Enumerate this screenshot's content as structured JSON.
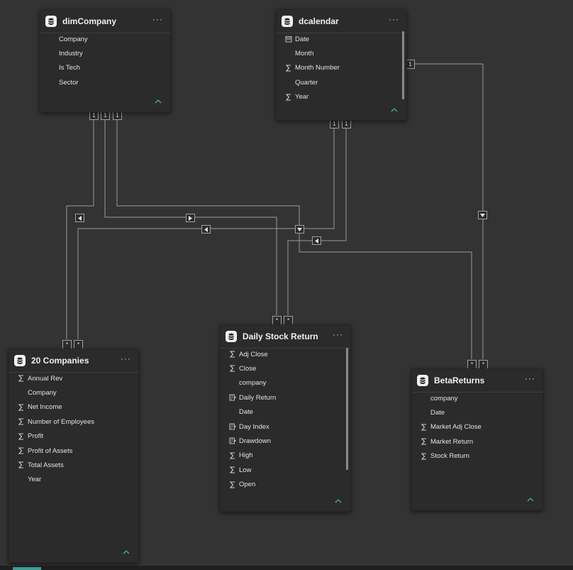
{
  "tables": {
    "dimCompany": {
      "title": "dimCompany",
      "fields": [
        {
          "label": "Company",
          "icon": ""
        },
        {
          "label": "Industry",
          "icon": ""
        },
        {
          "label": "Is Tech",
          "icon": ""
        },
        {
          "label": "Sector",
          "icon": ""
        }
      ]
    },
    "dcalendar": {
      "title": "dcalendar",
      "fields": [
        {
          "label": "Date",
          "icon": "calendar-icon"
        },
        {
          "label": "Month",
          "icon": ""
        },
        {
          "label": "Month Number",
          "icon": "sigma-icon"
        },
        {
          "label": "Quarter",
          "icon": ""
        },
        {
          "label": "Year",
          "icon": "sigma-icon"
        }
      ]
    },
    "companies20": {
      "title": "20 Companies",
      "fields": [
        {
          "label": "Annual Rev",
          "icon": "sigma-icon"
        },
        {
          "label": "Company",
          "icon": ""
        },
        {
          "label": "Net Income",
          "icon": "sigma-icon"
        },
        {
          "label": "Number of Employees",
          "icon": "sigma-icon"
        },
        {
          "label": "Profit",
          "icon": "sigma-icon"
        },
        {
          "label": "Profit of Assets",
          "icon": "sigma-icon"
        },
        {
          "label": "Total Assets",
          "icon": "sigma-icon"
        },
        {
          "label": "Year",
          "icon": ""
        }
      ]
    },
    "dailyStockReturn": {
      "title": "Daily Stock Return",
      "fields": [
        {
          "label": "Adj Close",
          "icon": "sigma-icon"
        },
        {
          "label": "Close",
          "icon": "sigma-icon"
        },
        {
          "label": "company",
          "icon": ""
        },
        {
          "label": "Daily Return",
          "icon": "calculator-icon"
        },
        {
          "label": "Date",
          "icon": ""
        },
        {
          "label": "Day Index",
          "icon": "calculator-icon"
        },
        {
          "label": "Drawdown",
          "icon": "calculator-icon"
        },
        {
          "label": "High",
          "icon": "sigma-icon"
        },
        {
          "label": "Low",
          "icon": "sigma-icon"
        },
        {
          "label": "Open",
          "icon": "sigma-icon"
        }
      ]
    },
    "betaReturns": {
      "title": "BetaReturns",
      "fields": [
        {
          "label": "company",
          "icon": ""
        },
        {
          "label": "Date",
          "icon": ""
        },
        {
          "label": "Market Adj Close",
          "icon": "sigma-icon"
        },
        {
          "label": "Market Return",
          "icon": "sigma-icon"
        },
        {
          "label": "Stock Return",
          "icon": "sigma-icon"
        }
      ]
    }
  },
  "menu_label": "···",
  "cardinality": {
    "one": "1",
    "many": "*"
  },
  "colors": {
    "background": "#333333",
    "card": "#2b2b2b",
    "line": "#a0a0a0",
    "accent": "#3a9e94"
  }
}
